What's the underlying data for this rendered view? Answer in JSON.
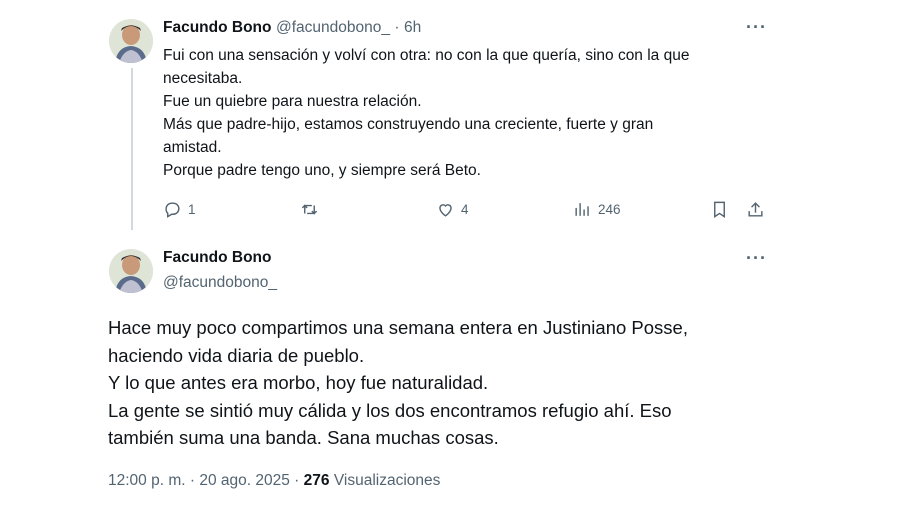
{
  "reply_tweet": {
    "author_name": "Facundo Bono",
    "author_handle": "@facundobono_",
    "separator": "·",
    "time": "6h",
    "lines": [
      "Fui con una sensación y volví con otra: no con la que quería, sino con la que",
      "necesitaba.",
      "Fue un quiebre para nuestra relación.",
      "Más que padre-hijo, estamos construyendo una creciente, fuerte y gran",
      "amistad.",
      "Porque padre tengo uno, y siempre será Beto."
    ],
    "replies_count": "1",
    "likes_count": "4",
    "views_count": "246"
  },
  "main_tweet": {
    "author_name": "Facundo Bono",
    "author_handle": "@facundobono_",
    "lines": [
      "Hace muy poco compartimos una semana entera en Justiniano Posse,",
      "haciendo vida diaria de pueblo.",
      "Y lo que antes era morbo, hoy fue naturalidad.",
      "La gente se sintió muy cálida y los dos encontramos refugio ahí. Eso",
      "también suma una banda. Sana muchas cosas."
    ],
    "time": "12:00 p. m.",
    "date": "20 ago. 2025",
    "views_count": "276",
    "views_label": "Visualizaciones"
  },
  "more_label": "···",
  "meta_separator": "·",
  "icons": [
    "reply-icon",
    "retweet-icon",
    "like-icon",
    "views-icon",
    "bookmark-icon",
    "share-icon",
    "more-icon"
  ],
  "colors": {
    "text": "#0f1419",
    "secondary": "#536471",
    "thread_line": "#cfd9de"
  }
}
